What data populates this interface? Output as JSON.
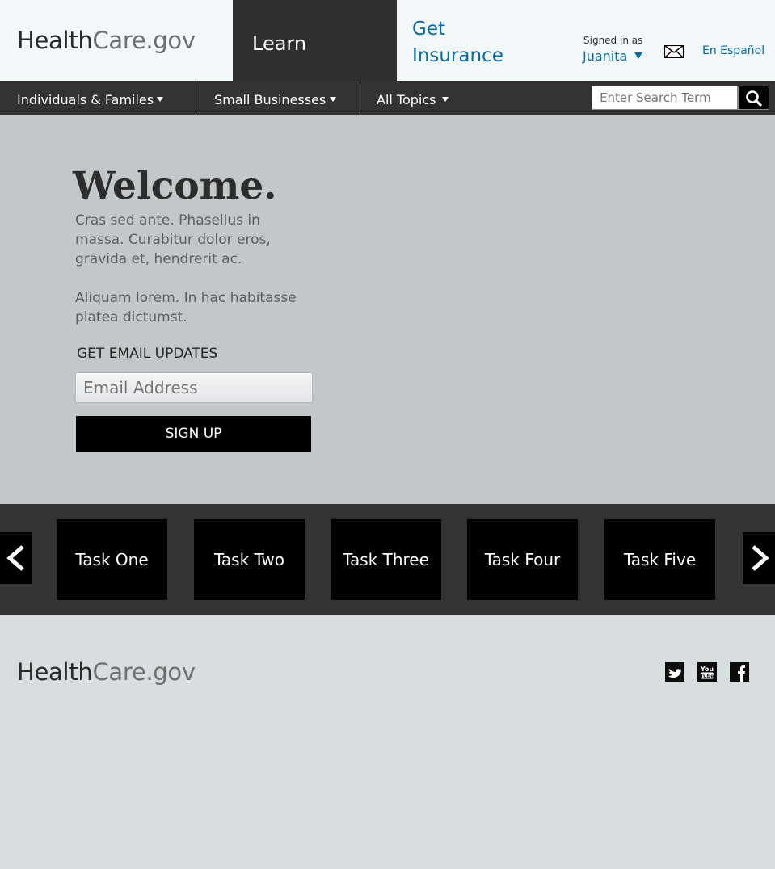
{
  "header": {
    "logo_part1": "Health",
    "logo_part2": "Care.gov",
    "tab_learn": "Learn",
    "tab_get_insurance": "Get Insurance",
    "signed_in_label": "Signed in as",
    "username": "Juanita",
    "espanol_link": "En Español"
  },
  "nav": {
    "items": [
      {
        "label": "Individuals & Familes"
      },
      {
        "label": "Small Businesses"
      },
      {
        "label": "All Topics"
      }
    ],
    "search_placeholder": "Enter Search Term"
  },
  "hero": {
    "title": "Welcome.",
    "paragraph1": "Cras sed ante. Phasellus in massa. Curabitur dolor eros, gravida et, hendrerit ac.",
    "paragraph2": "Aliquam lorem. In hac habitasse platea dictumst.",
    "email_heading": "GET EMAIL UPDATES",
    "email_placeholder": "Email Address",
    "signup_label": "SIGN UP"
  },
  "tasks": [
    "Task One",
    "Task Two",
    "Task Three",
    "Task Four",
    "Task Five"
  ],
  "footer": {
    "logo_part1": "Health",
    "logo_part2": "Care.gov",
    "social_icons": [
      "twitter-icon",
      "youtube-icon",
      "facebook-icon"
    ]
  },
  "colors": {
    "brand_blue": "#0a6ba1",
    "dark_bar": "#333333",
    "hero_bg": "#c2c7ca",
    "footer_bg": "#d8dde0"
  }
}
